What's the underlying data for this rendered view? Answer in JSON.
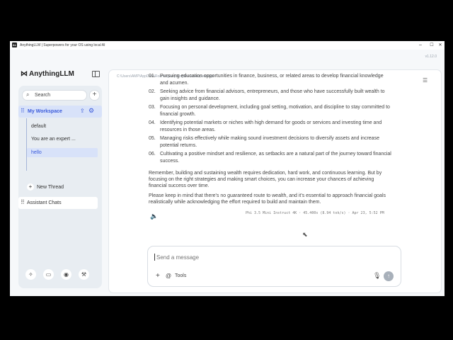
{
  "window": {
    "app_icon": "AL",
    "title": "AnythingLLM | Superpowers for your OS using local AI",
    "controls": [
      "–",
      "☐",
      "✕"
    ],
    "version": "v1.12.0"
  },
  "sidebar": {
    "brand": "AnythingLLM",
    "search_placeholder": "Search",
    "workspace_name": "My Workspace",
    "threads": [
      "default",
      "You are an expert ...",
      "hello"
    ],
    "new_thread": "New Thread",
    "assistant_chats": "Assistant Chats"
  },
  "chat": {
    "path": "C:\\Users\\AMP\\AppData\\Roaming\\anythingllm-desktop\\storage",
    "list": [
      {
        "num": "01.",
        "text": "Pursuing education opportunities in finance, business, or related areas to develop financial knowledge and acumen."
      },
      {
        "num": "02.",
        "text": "Seeking advice from financial advisors, entrepreneurs, and those who have successfully built wealth to gain insights and guidance."
      },
      {
        "num": "03.",
        "text": "Focusing on personal development, including goal setting, motivation, and discipline to stay committed to financial growth."
      },
      {
        "num": "04.",
        "text": "Identifying potential markets or niches with high demand for goods or services and investing time and resources in those areas."
      },
      {
        "num": "05.",
        "text": "Managing risks effectively while making sound investment decisions to diversify assets and increase potential returns."
      },
      {
        "num": "06.",
        "text": "Cultivating a positive mindset and resilience, as setbacks are a natural part of the journey toward financial success."
      }
    ],
    "para1": "Remember, building and sustaining wealth requires dedication, hard work, and continuous learning. But by focusing on the right strategies and making smart choices, you can increase your chances of achieving financial success over time.",
    "para2": "Please keep in mind that there's no guaranteed route to wealth, and it's essential to approach financial goals realistically while acknowledging the effort required to build and maintain them.",
    "meta": "Phi 3.5 Mini Instruct 4K · 45.400s (8.94 tok/s) · Apr 23, 5:52 PM"
  },
  "composer": {
    "placeholder": "Send a message",
    "tools": "Tools"
  }
}
